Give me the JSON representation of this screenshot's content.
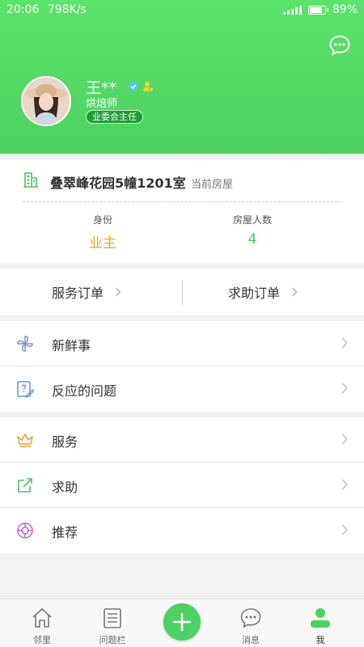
{
  "status_bar": {
    "time": "20:06",
    "speed": "798K/s",
    "battery": "89%",
    "battery_level": 0.89
  },
  "profile": {
    "name": "王**",
    "title": "烘焙师",
    "role": "业委会主任"
  },
  "house": {
    "name": "叠翠峰花园5幢1201室",
    "tag": "当前房屋",
    "identity_label": "身份",
    "identity_value": "业主",
    "people_label": "房屋人数",
    "people_value": "4"
  },
  "orders": {
    "service_label": "服务订单",
    "help_label": "求助订单"
  },
  "menu": {
    "group1": [
      {
        "label": "新鲜事",
        "icon": "pinwheel-icon"
      },
      {
        "label": "反应的问题",
        "icon": "question-edit-icon"
      }
    ],
    "group2": [
      {
        "label": "服务",
        "icon": "crown-icon"
      },
      {
        "label": "求助",
        "icon": "share-out-icon"
      },
      {
        "label": "推荐",
        "icon": "lifebuoy-icon"
      }
    ]
  },
  "tabbar": {
    "neighbor": "邻里",
    "board": "问题栏",
    "messages": "消息",
    "me": "我"
  },
  "colors": {
    "header_green": "#52d866",
    "accent_green": "#4cd262",
    "identity_orange": "#f0a030",
    "badge_green": "#1f9d37"
  }
}
